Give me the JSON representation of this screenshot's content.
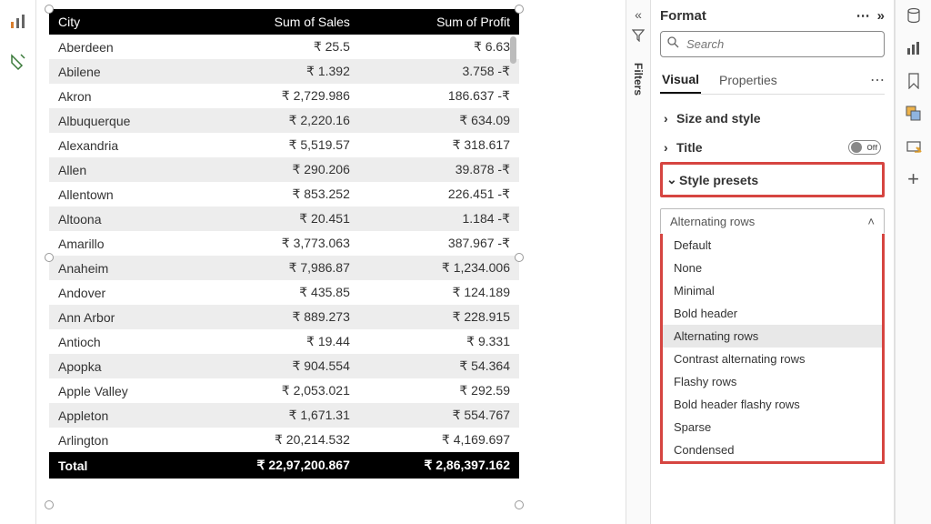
{
  "canvas": {
    "table": {
      "columns": [
        "City",
        "Sum of Sales",
        "Sum of Profit"
      ],
      "rows": [
        {
          "city": "Aberdeen",
          "sales": "₹ 25.5",
          "profit": "₹ 6.63"
        },
        {
          "city": "Abilene",
          "sales": "₹ 1.392",
          "profit": "3.758 -₹"
        },
        {
          "city": "Akron",
          "sales": "₹ 2,729.986",
          "profit": "186.637 -₹"
        },
        {
          "city": "Albuquerque",
          "sales": "₹ 2,220.16",
          "profit": "₹ 634.09"
        },
        {
          "city": "Alexandria",
          "sales": "₹ 5,519.57",
          "profit": "₹ 318.617"
        },
        {
          "city": "Allen",
          "sales": "₹ 290.206",
          "profit": "39.878 -₹"
        },
        {
          "city": "Allentown",
          "sales": "₹ 853.252",
          "profit": "226.451 -₹"
        },
        {
          "city": "Altoona",
          "sales": "₹ 20.451",
          "profit": "1.184 -₹"
        },
        {
          "city": "Amarillo",
          "sales": "₹ 3,773.063",
          "profit": "387.967 -₹"
        },
        {
          "city": "Anaheim",
          "sales": "₹ 7,986.87",
          "profit": "₹ 1,234.006"
        },
        {
          "city": "Andover",
          "sales": "₹ 435.85",
          "profit": "₹ 124.189"
        },
        {
          "city": "Ann Arbor",
          "sales": "₹ 889.273",
          "profit": "₹ 228.915"
        },
        {
          "city": "Antioch",
          "sales": "₹ 19.44",
          "profit": "₹ 9.331"
        },
        {
          "city": "Apopka",
          "sales": "₹ 904.554",
          "profit": "₹ 54.364"
        },
        {
          "city": "Apple Valley",
          "sales": "₹ 2,053.021",
          "profit": "₹ 292.59"
        },
        {
          "city": "Appleton",
          "sales": "₹ 1,671.31",
          "profit": "₹ 554.767"
        },
        {
          "city": "Arlington",
          "sales": "₹ 20,214.532",
          "profit": "₹ 4,169.697"
        }
      ],
      "total_label": "Total",
      "total_sales": "₹ 22,97,200.867",
      "total_profit": "₹ 2,86,397.162"
    }
  },
  "filters": {
    "label": "Filters"
  },
  "format": {
    "title": "Format",
    "search_placeholder": "Search",
    "tabs": {
      "visual": "Visual",
      "properties": "Properties"
    },
    "sections": {
      "size_style": "Size and style",
      "title": "Title",
      "title_toggle": "Off",
      "style_presets": "Style presets"
    },
    "preset_selected": "Alternating rows",
    "preset_options": [
      "Default",
      "None",
      "Minimal",
      "Bold header",
      "Alternating rows",
      "Contrast alternating rows",
      "Flashy rows",
      "Bold header flashy rows",
      "Sparse",
      "Condensed"
    ]
  }
}
